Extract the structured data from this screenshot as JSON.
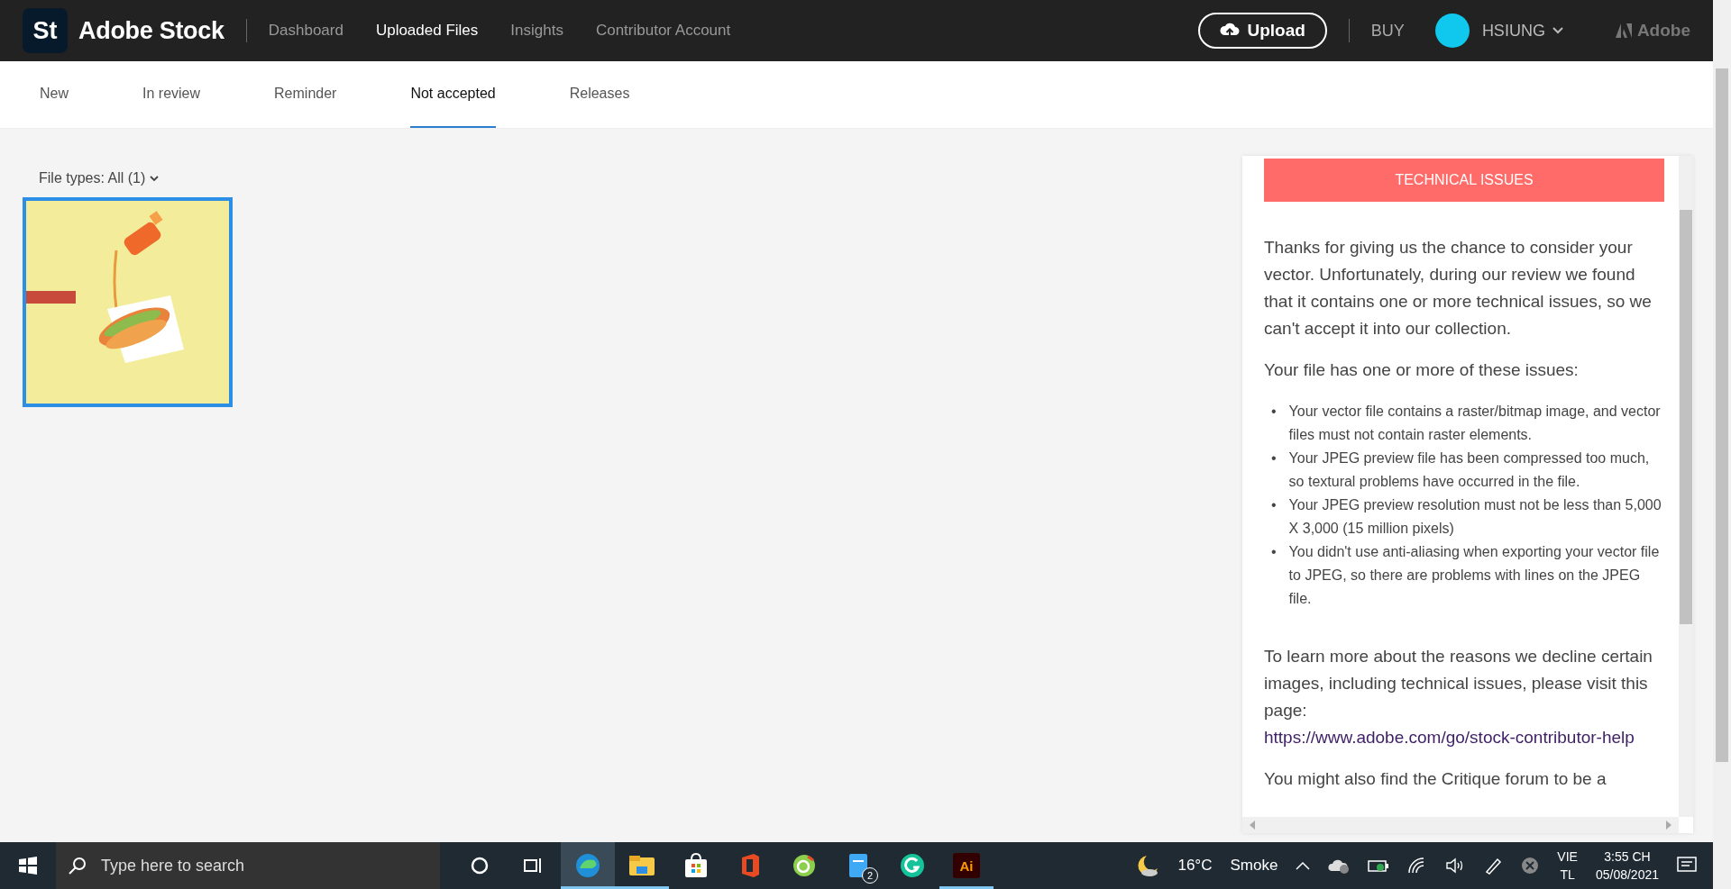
{
  "header": {
    "logo_mark": "St",
    "brand": "Adobe Stock",
    "nav": [
      {
        "label": "Dashboard",
        "selected": false
      },
      {
        "label": "Uploaded Files",
        "selected": true
      },
      {
        "label": "Insights",
        "selected": false
      },
      {
        "label": "Contributor Account",
        "selected": false
      }
    ],
    "upload_button": "Upload",
    "buy": "BUY",
    "user": {
      "name": "HSIUNG"
    },
    "adobe": "Adobe"
  },
  "tabs": [
    {
      "label": "New",
      "selected": false
    },
    {
      "label": "In review",
      "selected": false
    },
    {
      "label": "Reminder",
      "selected": false
    },
    {
      "label": "Not accepted",
      "selected": true
    },
    {
      "label": "Releases",
      "selected": false
    }
  ],
  "filter": "File types: All (1)",
  "thumbnails": [
    {
      "kind": "picture",
      "selected": true
    }
  ],
  "panel": {
    "banner": "TECHNICAL ISSUES",
    "intro": "Thanks for giving us the chance to consider your vector. Unfortunately, during our review we found that it contains one or more technical issues, so we can't accept it into our collection.",
    "issues_heading": "Your file has one or more of these issues:",
    "bullet": "•",
    "issues": [
      "Your vector file contains a raster/bitmap image, and vector files must not contain raster elements.",
      "Your JPEG preview file has been compressed too much, so textural problems have occurred in the file.",
      "Your JPEG preview resolution must not be less than 5,000 X 3,000 (15 million pixels)",
      "You didn't use anti-aliasing when exporting your vector file to JPEG, so there are problems with lines on the JPEG file."
    ],
    "help_text": "To learn more about the reasons we decline certain images, including technical issues, please visit this page:",
    "help_link": "https://www.adobe.com/go/stock-contributor-help",
    "closing": "You might also find the Critique forum to be a"
  },
  "taskbar": {
    "search_placeholder": "Type here to search",
    "apps": [
      {
        "kind": "cortana",
        "selected": false,
        "running": false
      },
      {
        "kind": "taskview",
        "selected": false,
        "running": false
      },
      {
        "kind": "edge",
        "selected": true,
        "running": true
      },
      {
        "kind": "explorer",
        "selected": false,
        "running": true
      },
      {
        "kind": "store",
        "selected": false,
        "running": false
      },
      {
        "kind": "office",
        "selected": false,
        "running": false
      },
      {
        "kind": "refresh",
        "selected": false,
        "running": false
      },
      {
        "kind": "files",
        "selected": false,
        "running": false,
        "badge": "2"
      },
      {
        "kind": "grammarly",
        "selected": false,
        "running": false
      },
      {
        "kind": "illustrator",
        "selected": false,
        "running": true,
        "label": "Ai"
      }
    ],
    "weather": {
      "temp": "16°C",
      "condition": "Smoke"
    },
    "language": [
      "VIE",
      "TL"
    ],
    "time": "3:55 CH",
    "date": "05/08/2021"
  }
}
